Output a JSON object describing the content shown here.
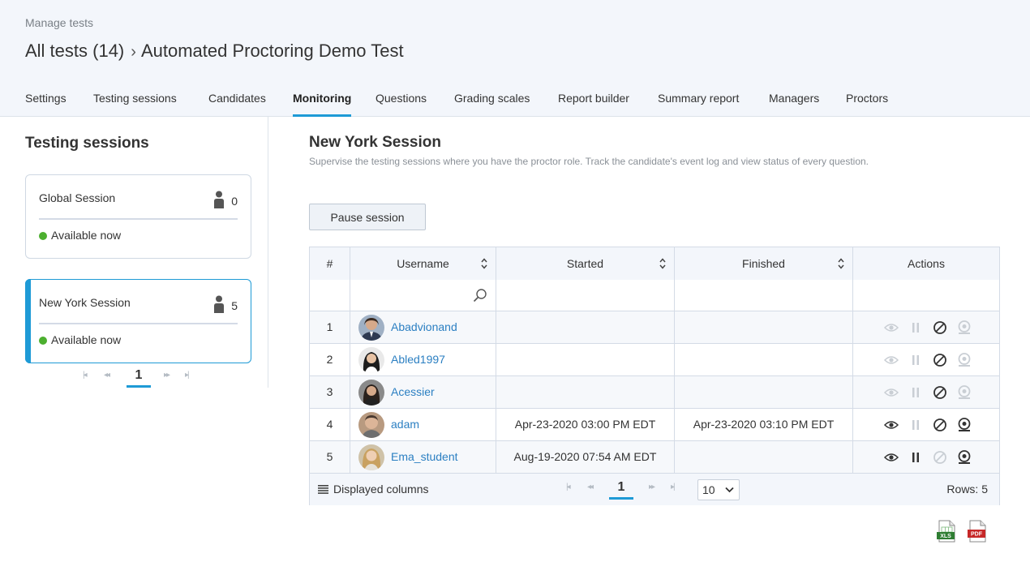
{
  "header": {
    "manage_label": "Manage tests",
    "breadcrumb_root": "All tests (14)",
    "breadcrumb_separator": "›",
    "breadcrumb_current": "Automated Proctoring Demo Test"
  },
  "tabs": [
    {
      "label": "Settings",
      "active": false
    },
    {
      "label": "Testing sessions",
      "active": false
    },
    {
      "label": "Candidates",
      "active": false
    },
    {
      "label": "Monitoring",
      "active": true
    },
    {
      "label": "Questions",
      "active": false
    },
    {
      "label": "Grading scales",
      "active": false
    },
    {
      "label": "Report builder",
      "active": false
    },
    {
      "label": "Summary report",
      "active": false
    },
    {
      "label": "Managers",
      "active": false
    },
    {
      "label": "Proctors",
      "active": false
    }
  ],
  "sidebar": {
    "title": "Testing sessions",
    "sessions": [
      {
        "name": "Global Session",
        "count": "0",
        "status": "Available now",
        "selected": false
      },
      {
        "name": "New York Session",
        "count": "5",
        "status": "Available now",
        "selected": true
      }
    ],
    "pager": {
      "first": "|◂",
      "prev": "◂◂",
      "page": "1",
      "next": "▸▸",
      "last": "▸|"
    }
  },
  "main": {
    "title": "New York Session",
    "description": "Supervise the testing sessions where you have the proctor role. Track the candidate's event log and view status of every question.",
    "pause_button": "Pause session"
  },
  "grid": {
    "columns": [
      "#",
      "Username",
      "Started",
      "Finished",
      "Actions"
    ],
    "rows": [
      {
        "num": "1",
        "username": "Abadvionand",
        "started": "",
        "finished": "",
        "view_enabled": false,
        "pause_enabled": false,
        "block_enabled": true,
        "webcam_enabled": false
      },
      {
        "num": "2",
        "username": "Abled1997",
        "started": "",
        "finished": "",
        "view_enabled": false,
        "pause_enabled": false,
        "block_enabled": true,
        "webcam_enabled": false
      },
      {
        "num": "3",
        "username": "Acessier",
        "started": "",
        "finished": "",
        "view_enabled": false,
        "pause_enabled": false,
        "block_enabled": true,
        "webcam_enabled": false
      },
      {
        "num": "4",
        "username": "adam",
        "started": "Apr-23-2020 03:00 PM EDT",
        "finished": "Apr-23-2020 03:10 PM EDT",
        "view_enabled": true,
        "pause_enabled": false,
        "block_enabled": true,
        "webcam_enabled": true
      },
      {
        "num": "5",
        "username": "Ema_student",
        "started": "Aug-19-2020 07:54 AM EDT",
        "finished": "",
        "view_enabled": true,
        "pause_enabled": true,
        "block_enabled": false,
        "webcam_enabled": true
      }
    ],
    "footer": {
      "displayed_columns": "Displayed columns",
      "pager": {
        "first": "|◂",
        "prev": "◂◂",
        "page": "1",
        "next": "▸▸",
        "last": "▸|"
      },
      "page_size": "10",
      "rows_label": "Rows: 5"
    }
  },
  "exports": {
    "xls_label": "XLS",
    "pdf_label": "PDF"
  },
  "colors": {
    "accent": "#1e9ad6",
    "link": "#2b7fc2",
    "available": "#4caf2f",
    "xls": "#2e7d32",
    "pdf": "#c62828"
  }
}
